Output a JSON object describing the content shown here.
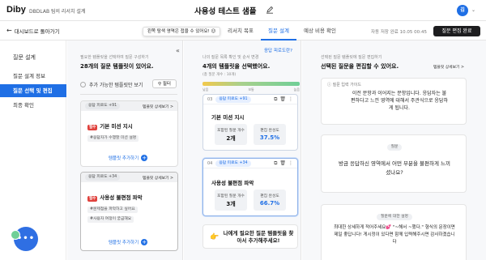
{
  "topbar": {
    "logo": "Diby",
    "brand_sub": "DBDLAB 팀의 리서치 설계",
    "title": "사용성 테스트 샘플",
    "avatar": "김"
  },
  "subbar": {
    "back_label": "대시보드로 돌아가기",
    "tooltip": "왼쪽 탐색 영역은 접을 수 있어요! 😉",
    "tabs": [
      "리서치 목표",
      "질문 설계",
      "예상 비용 확인"
    ],
    "autosave": "자동 저장 완료 10.05 00:45",
    "finish": "질문 편집 완료"
  },
  "sidebar": {
    "title": "질문 설계",
    "items": [
      "질문 설계 정보",
      "질문 선택 및 편집",
      "최종 확인"
    ],
    "active_index": 1
  },
  "panel1": {
    "hint": "필요한 템플릿을 선택하여 질문 구성하기",
    "heading": "28개의 질문 템플릿이 있어요.",
    "check_label": "추가 가능한 템플릿만 보기",
    "filter": "필터",
    "cards": [
      {
        "badge": "응답 피로도 +91",
        "detail": "템플릿 상세보기 >",
        "tag": "필수",
        "title": "기본 미션 지시",
        "chips": [
          "#응답자가 수행할 미션 설명"
        ],
        "add": "템플릿 추가하기"
      },
      {
        "badge": "응답 피로도 +34",
        "detail": "템플릿 상세보기 >",
        "tag": "필수",
        "title": "사용성 불편점 파악",
        "chips": [
          "#문제점을 파악하고 싶어요",
          "#사용자 여정이 궁금해요"
        ],
        "add": "템플릿 추가하기"
      }
    ]
  },
  "panel2": {
    "hint": "나의 질문 목록 확인 및 순서 변경",
    "heading": "4개의 템플릿을 선택했어요.",
    "count_hint": "(총 질문 개수 : 10개)",
    "fatigue_link": "응답 피로도란?",
    "progress_labels": [
      "낮음",
      "보통",
      "높음"
    ],
    "cards": [
      {
        "num": "03",
        "badge": "응답 피로도 +91",
        "title": "기본 미션 지시",
        "stat1_label": "포함된 질문 개수",
        "stat1_value": "2개",
        "stat2_label": "편집 완성도",
        "stat2_value": "37.5%"
      },
      {
        "num": "04",
        "badge": "응답 피로도 +34",
        "title": "사용성 불편점 파악",
        "stat1_label": "포함된 질문 개수",
        "stat1_value": "3개",
        "stat2_label": "편집 완성도",
        "stat2_value": "66.7%"
      }
    ],
    "cta": "나에게 필요한 질문 템플릿을 찾아서 추가해주세요!"
  },
  "panel3": {
    "hint": "선택된 질문 템플릿에 질문 편집하기",
    "heading": "선택된 질문을 편집할 수 있어요.",
    "detail": "템플릿 상세보기 >",
    "guide_label": "ⓘ 질문 입력 가이드",
    "guide_text": "이전 문항과 이어지는 문항입니다. 응답자는 불편하다고 느낀 영역에 대해서 주관식으로 응답하게 됩니다.",
    "q_label": "질문",
    "q_text": "방금 응답하신 영역에서 어떤 부분을 불편하게 느끼셨나요?",
    "guide2_label": "질문에 대한 설명",
    "guide2_text": "최대한 상세하게 적어주세요💕 \"~해서 ~했다.\" 형식의 문장이면 제일 좋답니다! 게시정이 있다면 함께 입력해주시면 감사하겠습니다"
  }
}
